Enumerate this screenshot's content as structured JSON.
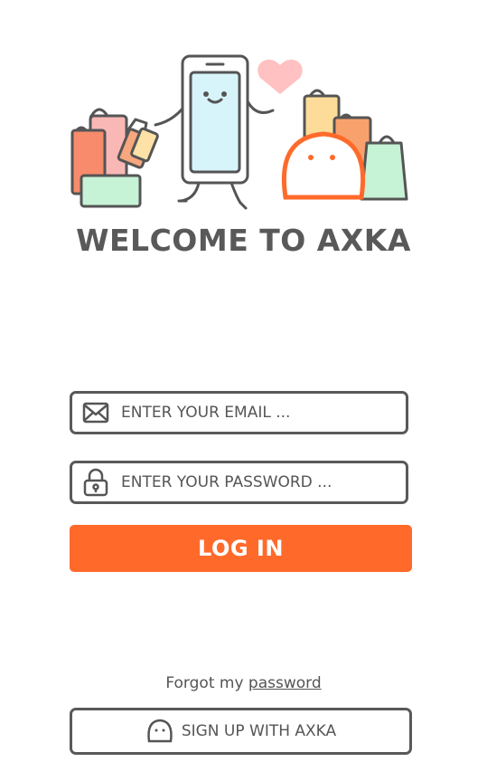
{
  "colors": {
    "accent": "#ff6a2b",
    "text": "#595959",
    "background": "#ffffff"
  },
  "header": {
    "illustration": "shopping-phone-mascot-illustration",
    "title": "WELCOME TO AXKA"
  },
  "login_form": {
    "email": {
      "icon": "envelope-icon",
      "placeholder": "ENTER YOUR EMAIL ...",
      "value": ""
    },
    "password": {
      "icon": "padlock-icon",
      "placeholder": "ENTER YOUR PASSWORD ...",
      "value": ""
    },
    "login_label": "LOG IN"
  },
  "forgot": {
    "prefix": "Forgot my",
    "link": "password"
  },
  "signup": {
    "icon": "axka-mascot-icon",
    "label": "SIGN UP WITH AXKA"
  }
}
